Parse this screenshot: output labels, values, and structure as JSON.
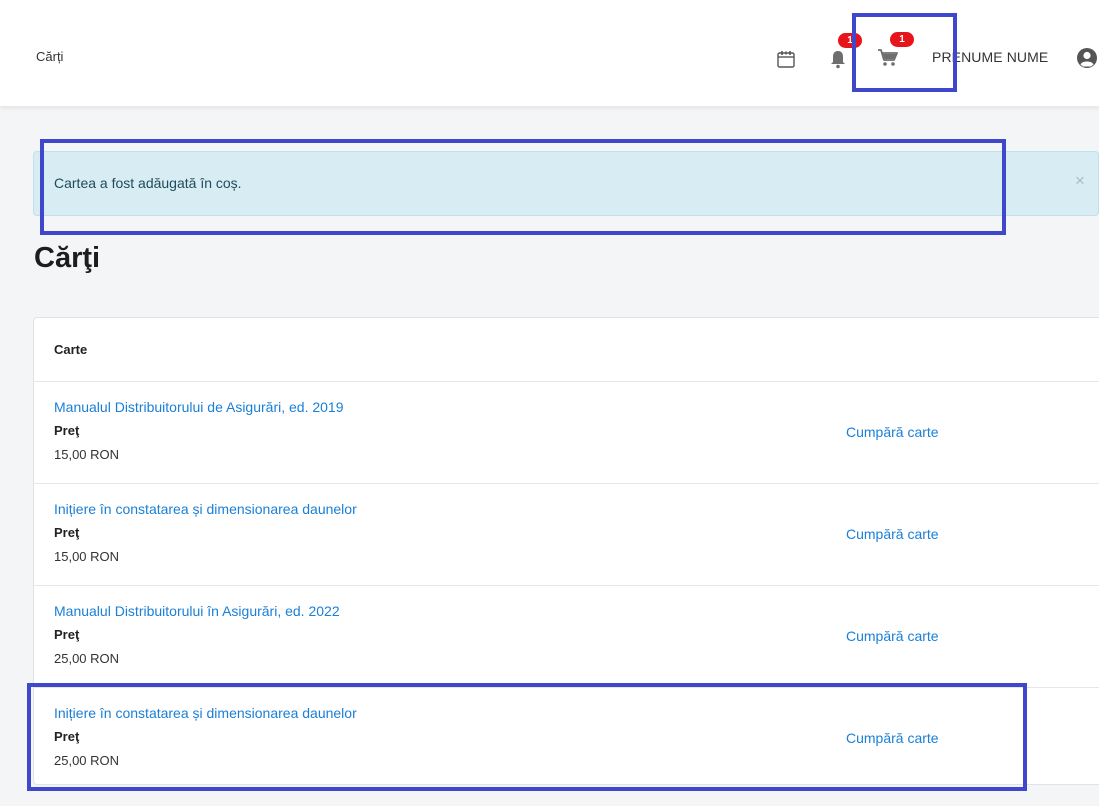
{
  "header": {
    "breadcrumb": "Cărți",
    "notifications_badge": "1",
    "cart_badge": "1",
    "user_name": "PRENUME NUME",
    "icons": [
      "calendar-icon",
      "bell-icon",
      "cart-icon",
      "user-circle-icon"
    ]
  },
  "alert": {
    "message": "Cartea a fost adăugată în coș.",
    "close": "×"
  },
  "page": {
    "title": "Cărţi"
  },
  "table": {
    "column_header": "Carte",
    "rows": [
      {
        "title": "Manualul Distribuitorului de Asigurări, ed. 2019",
        "price_label": "Preţ",
        "price": "15,00 RON",
        "action": "Cumpără carte"
      },
      {
        "title": "Inițiere în constatarea și dimensionarea daunelor",
        "price_label": "Preţ",
        "price": "15,00 RON",
        "action": "Cumpără carte"
      },
      {
        "title": "Manualul Distribuitorului în Asigurări, ed. 2022",
        "price_label": "Preţ",
        "price": "25,00 RON",
        "action": "Cumpără carte"
      },
      {
        "title": "Inițiere în constatarea și dimensionarea daunelor",
        "price_label": "Preţ",
        "price": "25,00 RON",
        "action": "Cumpără carte"
      }
    ]
  },
  "colors": {
    "annotation": "#3f48cc",
    "link": "#1a7fd6",
    "badge": "#e8141c",
    "alert_bg": "#d7ecf3"
  }
}
